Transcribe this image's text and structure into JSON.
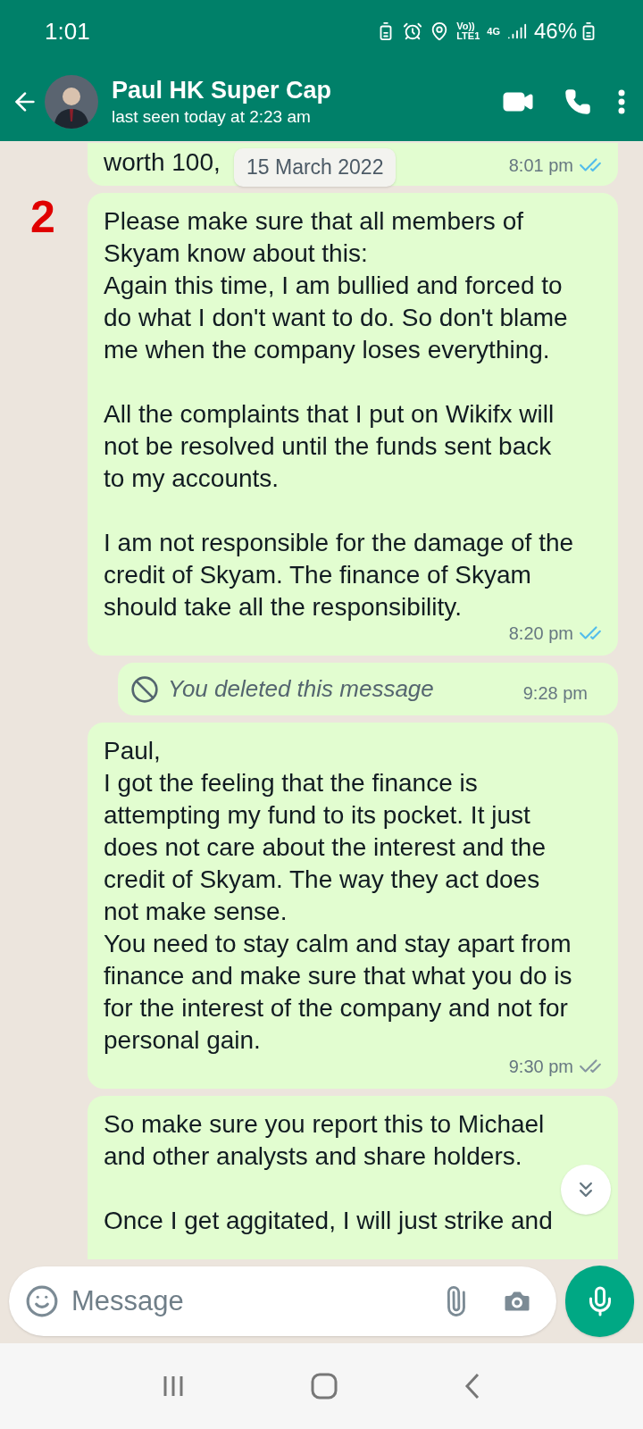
{
  "status_bar": {
    "time": "1:01",
    "network_top": "Vo))",
    "network_bottom": "LTE1",
    "data": "4G",
    "battery": "46%"
  },
  "header": {
    "name": "Paul HK Super Cap",
    "subtitle": "last seen today at 2:23 am"
  },
  "date_chip": "15 March 2022",
  "annotation": "2",
  "messages": [
    {
      "kind": "text",
      "text": "worth 100,",
      "time": "8:01 pm",
      "read": true
    },
    {
      "kind": "text",
      "text": "Please make sure that all members of Skyam know about this:\nAgain this time, I am bullied and forced to do what I don't want to do. So don't blame me when the company loses everything.\n\nAll the complaints that I put on Wikifx will not be resolved until the funds sent back to my accounts.\n\nI am not responsible for the damage of the credit of Skyam. The finance of Skyam should take all the responsibility.",
      "time": "8:20 pm",
      "read": true
    },
    {
      "kind": "deleted",
      "text": "You deleted this message",
      "time": "9:28 pm"
    },
    {
      "kind": "text",
      "text": "Paul,\nI got the feeling that the finance is attempting my fund to its pocket. It just does not care about the interest and the credit of Skyam. The way they act does not make sense.\nYou need to stay calm and stay apart from finance and make sure that what you do is for the interest of the company and not for personal gain.",
      "time": "9:30 pm",
      "read": false
    },
    {
      "kind": "partial",
      "text": "So make sure you report this to Michael and other analysts and share holders.\n\nOnce I get aggitated, I will just strike and"
    }
  ],
  "composer": {
    "placeholder": "Message"
  }
}
